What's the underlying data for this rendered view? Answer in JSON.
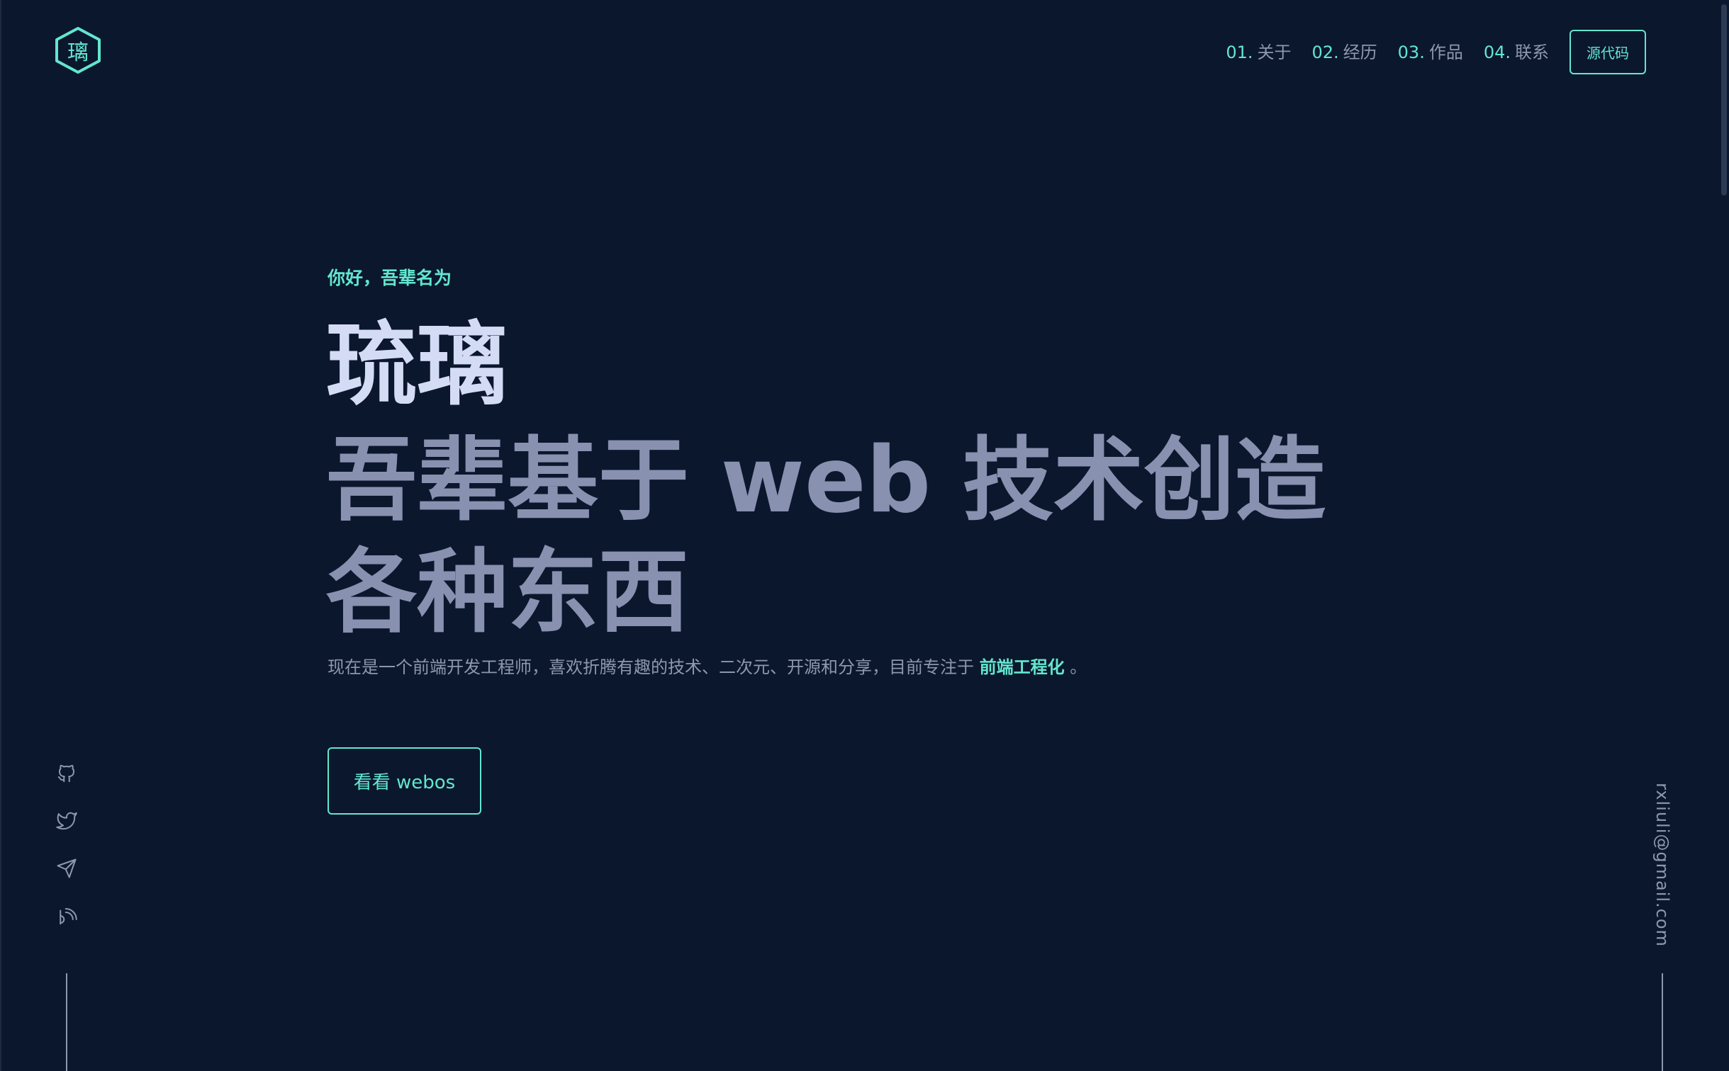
{
  "logo": {
    "glyph": "璃",
    "icon": "hexagon-logo-icon",
    "color": "#63e6cf"
  },
  "nav": {
    "items": [
      {
        "num": "01.",
        "label": "关于"
      },
      {
        "num": "02.",
        "label": "经历"
      },
      {
        "num": "03.",
        "label": "作品"
      },
      {
        "num": "04.",
        "label": "联系"
      }
    ],
    "source_button": "源代码"
  },
  "hero": {
    "greeting": "你好，吾辈名为",
    "name": "琉璃",
    "tagline": "吾辈基于 web 技术创造各种东西",
    "description_prefix": "现在是一个前端开发工程师，喜欢折腾有趣的技术、二次元、开源和分享，目前专注于",
    "description_highlight": "前端工程化",
    "description_suffix": "。",
    "cta_label": "看看 webos"
  },
  "socials": [
    {
      "icon": "github-icon"
    },
    {
      "icon": "twitter-icon"
    },
    {
      "icon": "telegram-icon"
    },
    {
      "icon": "blog-icon"
    }
  ],
  "email": "rxliuli@gmail.com",
  "colors": {
    "background": "#0b172c",
    "accent": "#63e6cf",
    "heading_light": "#d4dcf5",
    "heading_muted": "#8891b0",
    "text_muted": "#8d97b0"
  }
}
